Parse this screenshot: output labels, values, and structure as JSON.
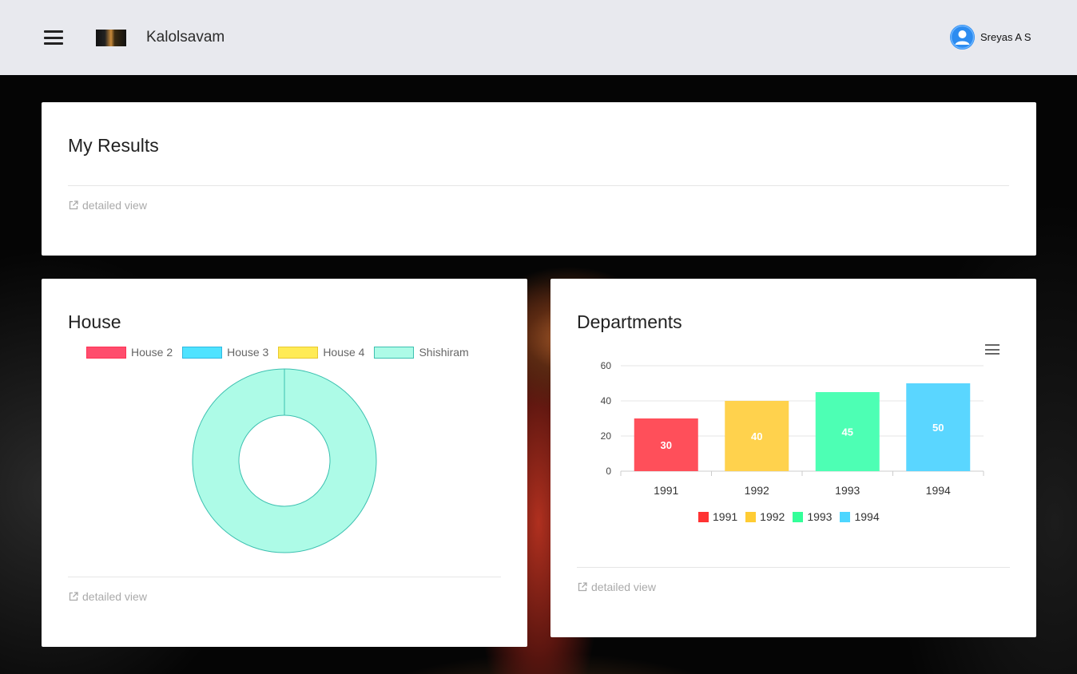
{
  "header": {
    "app_title": "Kalolsavam",
    "user_name": "Sreyas A S"
  },
  "my_results": {
    "title": "My Results",
    "detail_link": "detailed view"
  },
  "house": {
    "title": "House",
    "detail_link": "detailed view",
    "legend": [
      {
        "label": "House 2",
        "fill": "#ff4d6d",
        "stroke": "#ff3355"
      },
      {
        "label": "House 3",
        "fill": "#4fe3ff",
        "stroke": "#30b8e0"
      },
      {
        "label": "House 4",
        "fill": "#ffeb55",
        "stroke": "#e8c830"
      },
      {
        "label": "Shishiram",
        "fill": "#adfbe7",
        "stroke": "#3cc0b0"
      }
    ]
  },
  "departments": {
    "title": "Departments",
    "detail_link": "detailed view"
  },
  "chart_data": [
    {
      "type": "pie",
      "variant": "doughnut",
      "categories": [
        "House 2",
        "House 3",
        "House 4",
        "Shishiram"
      ],
      "values": [
        0,
        0,
        0,
        1
      ],
      "colors": [
        "#ff4d6d",
        "#4fe3ff",
        "#ffeb55",
        "#adfbe7"
      ],
      "legend": "top"
    },
    {
      "type": "bar",
      "categories": [
        "1991",
        "1992",
        "1993",
        "1994"
      ],
      "values": [
        30,
        40,
        45,
        50
      ],
      "data_labels": [
        "30",
        "40",
        "45",
        "50"
      ],
      "y_ticks": [
        "0",
        "20",
        "40",
        "60"
      ],
      "ylim": [
        0,
        60
      ],
      "colors": [
        "#ff4f5a",
        "#ffd24d",
        "#4dffb4",
        "#5ad6ff"
      ],
      "legend_colors": [
        "#ff3333",
        "#ffcc33",
        "#33ff99",
        "#4dd6ff"
      ],
      "legend": "bottom",
      "grid": true
    }
  ]
}
